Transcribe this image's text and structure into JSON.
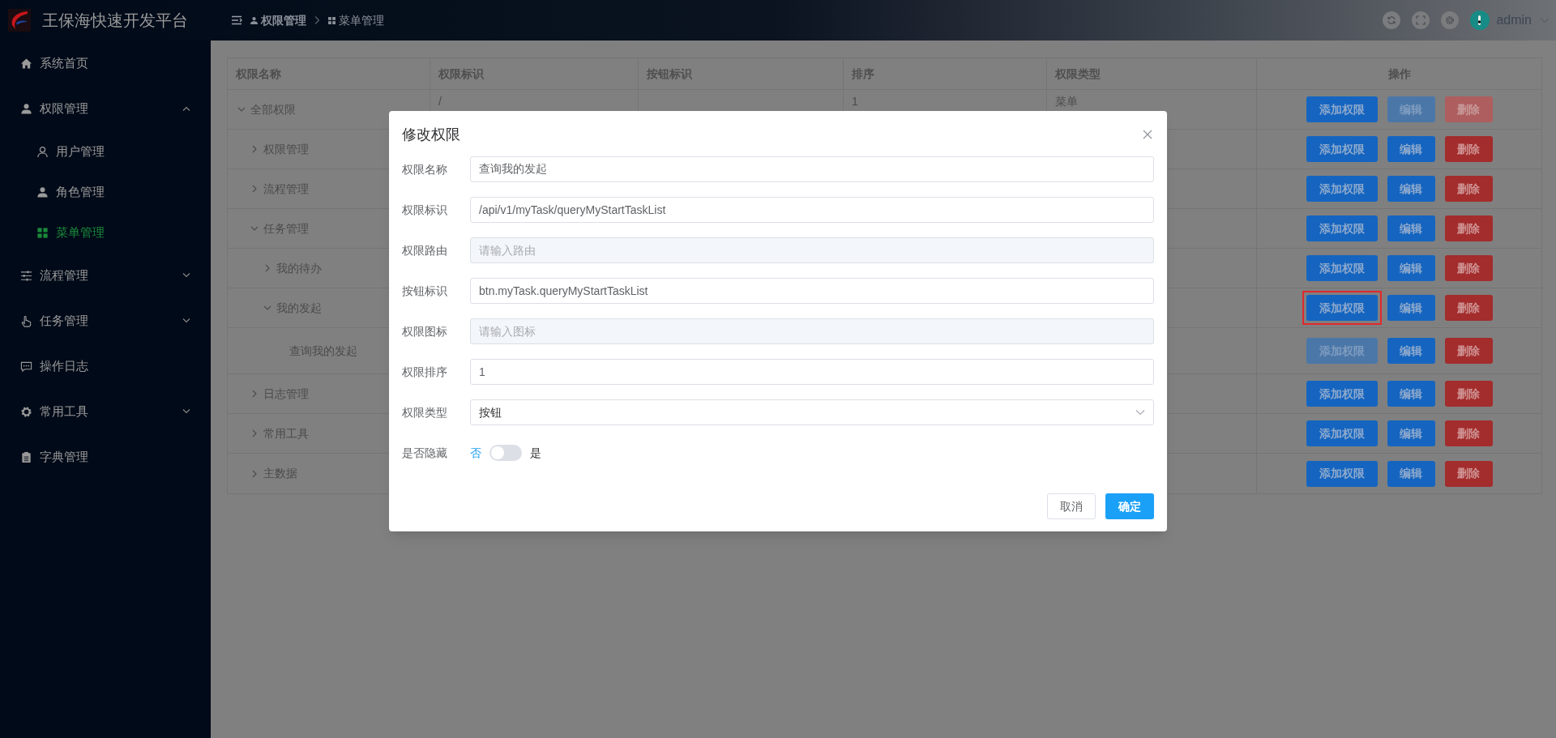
{
  "header": {
    "title": "王保海快速开发平台",
    "breadcrumb": [
      "权限管理",
      "菜单管理"
    ],
    "user": {
      "name": "admin"
    }
  },
  "sidebar": {
    "items": [
      {
        "label": "系统首页",
        "selected": false
      },
      {
        "label": "权限管理",
        "selected": false,
        "expanded": true,
        "children": [
          {
            "label": "用户管理",
            "selected": false
          },
          {
            "label": "角色管理",
            "selected": false
          },
          {
            "label": "菜单管理",
            "selected": true
          }
        ]
      },
      {
        "label": "流程管理",
        "selected": false,
        "expanded": false
      },
      {
        "label": "任务管理",
        "selected": false,
        "expanded": false
      },
      {
        "label": "操作日志",
        "selected": false
      },
      {
        "label": "常用工具",
        "selected": false,
        "expanded": false
      },
      {
        "label": "字典管理",
        "selected": false
      }
    ]
  },
  "table": {
    "columns": [
      "权限名称",
      "权限标识",
      "按钮标识",
      "排序",
      "权限类型",
      "操作"
    ],
    "rows": [
      {
        "name": "全部权限",
        "expanded": true,
        "identifier": "/",
        "sort": "1",
        "type": "菜单",
        "actions": [
          {
            "label": "添加权限",
            "kind": "add",
            "disabled": false,
            "highlighted": false
          },
          {
            "label": "编辑",
            "kind": "edit",
            "disabled": true,
            "highlighted": false
          },
          {
            "label": "删除",
            "kind": "delete",
            "disabled": true,
            "highlighted": false
          }
        ],
        "children": [
          {
            "name": "权限管理",
            "expanded": false,
            "actions": [
              {
                "label": "添加权限",
                "kind": "add",
                "disabled": false,
                "highlighted": false
              },
              {
                "label": "编辑",
                "kind": "edit",
                "disabled": false,
                "highlighted": false
              },
              {
                "label": "删除",
                "kind": "delete",
                "disabled": false,
                "highlighted": false
              }
            ]
          },
          {
            "name": "流程管理",
            "expanded": false,
            "actions": [
              {
                "label": "添加权限",
                "kind": "add",
                "disabled": false,
                "highlighted": false
              },
              {
                "label": "编辑",
                "kind": "edit",
                "disabled": false,
                "highlighted": false
              },
              {
                "label": "删除",
                "kind": "delete",
                "disabled": false,
                "highlighted": false
              }
            ]
          },
          {
            "name": "任务管理",
            "expanded": true,
            "actions": [
              {
                "label": "添加权限",
                "kind": "add",
                "disabled": false,
                "highlighted": false
              },
              {
                "label": "编辑",
                "kind": "edit",
                "disabled": false,
                "highlighted": false
              },
              {
                "label": "删除",
                "kind": "delete",
                "disabled": false,
                "highlighted": false
              }
            ],
            "children": [
              {
                "name": "我的待办",
                "expanded": false,
                "actions": [
                  {
                    "label": "添加权限",
                    "kind": "add",
                    "disabled": false,
                    "highlighted": false
                  },
                  {
                    "label": "编辑",
                    "kind": "edit",
                    "disabled": false,
                    "highlighted": false
                  },
                  {
                    "label": "删除",
                    "kind": "delete",
                    "disabled": false,
                    "highlighted": false
                  }
                ]
              },
              {
                "name": "我的发起",
                "expanded": true,
                "actions": [
                  {
                    "label": "添加权限",
                    "kind": "add",
                    "disabled": false,
                    "highlighted": true
                  },
                  {
                    "label": "编辑",
                    "kind": "edit",
                    "disabled": false,
                    "highlighted": false
                  },
                  {
                    "label": "删除",
                    "kind": "delete",
                    "disabled": false,
                    "highlighted": false
                  }
                ],
                "children": [
                  {
                    "name": "查询我的发起",
                    "actions": [
                      {
                        "label": "添加权限",
                        "kind": "add",
                        "disabled": true,
                        "highlighted": false
                      },
                      {
                        "label": "编辑",
                        "kind": "edit",
                        "disabled": false,
                        "highlighted": false
                      },
                      {
                        "label": "删除",
                        "kind": "delete",
                        "disabled": false,
                        "highlighted": false
                      }
                    ]
                  }
                ]
              }
            ]
          },
          {
            "name": "日志管理",
            "expanded": false,
            "actions": [
              {
                "label": "添加权限",
                "kind": "add",
                "disabled": false,
                "highlighted": false
              },
              {
                "label": "编辑",
                "kind": "edit",
                "disabled": false,
                "highlighted": false
              },
              {
                "label": "删除",
                "kind": "delete",
                "disabled": false,
                "highlighted": false
              }
            ]
          },
          {
            "name": "常用工具",
            "expanded": false,
            "actions": [
              {
                "label": "添加权限",
                "kind": "add",
                "disabled": false,
                "highlighted": false
              },
              {
                "label": "编辑",
                "kind": "edit",
                "disabled": false,
                "highlighted": false
              },
              {
                "label": "删除",
                "kind": "delete",
                "disabled": false,
                "highlighted": false
              }
            ]
          },
          {
            "name": "主数据",
            "expanded": false,
            "actions": [
              {
                "label": "添加权限",
                "kind": "add",
                "disabled": false,
                "highlighted": false
              },
              {
                "label": "编辑",
                "kind": "edit",
                "disabled": false,
                "highlighted": false
              },
              {
                "label": "删除",
                "kind": "delete",
                "disabled": false,
                "highlighted": false
              }
            ]
          }
        ]
      }
    ]
  },
  "dialog": {
    "title": "修改权限",
    "fields": [
      {
        "label": "权限名称",
        "kind": "text",
        "value": "查询我的发起",
        "disabled": false
      },
      {
        "label": "权限标识",
        "kind": "text",
        "value": "/api/v1/myTask/queryMyStartTaskList",
        "disabled": false
      },
      {
        "label": "权限路由",
        "kind": "text",
        "placeholder": "请输入路由",
        "disabled": true
      },
      {
        "label": "按钮标识",
        "kind": "text",
        "value": "btn.myTask.queryMyStartTaskList",
        "disabled": false
      },
      {
        "label": "权限图标",
        "kind": "text",
        "placeholder": "请输入图标",
        "disabled": true
      },
      {
        "label": "权限排序",
        "kind": "text",
        "value": "1",
        "disabled": false
      },
      {
        "label": "权限类型",
        "kind": "select",
        "value": "按钮"
      },
      {
        "label": "是否隐藏",
        "kind": "switch",
        "off_label": "否",
        "on_label": "是",
        "on": false
      }
    ],
    "buttons": [
      {
        "label": "取消",
        "kind": "default"
      },
      {
        "label": "确定",
        "kind": "primary"
      }
    ]
  }
}
